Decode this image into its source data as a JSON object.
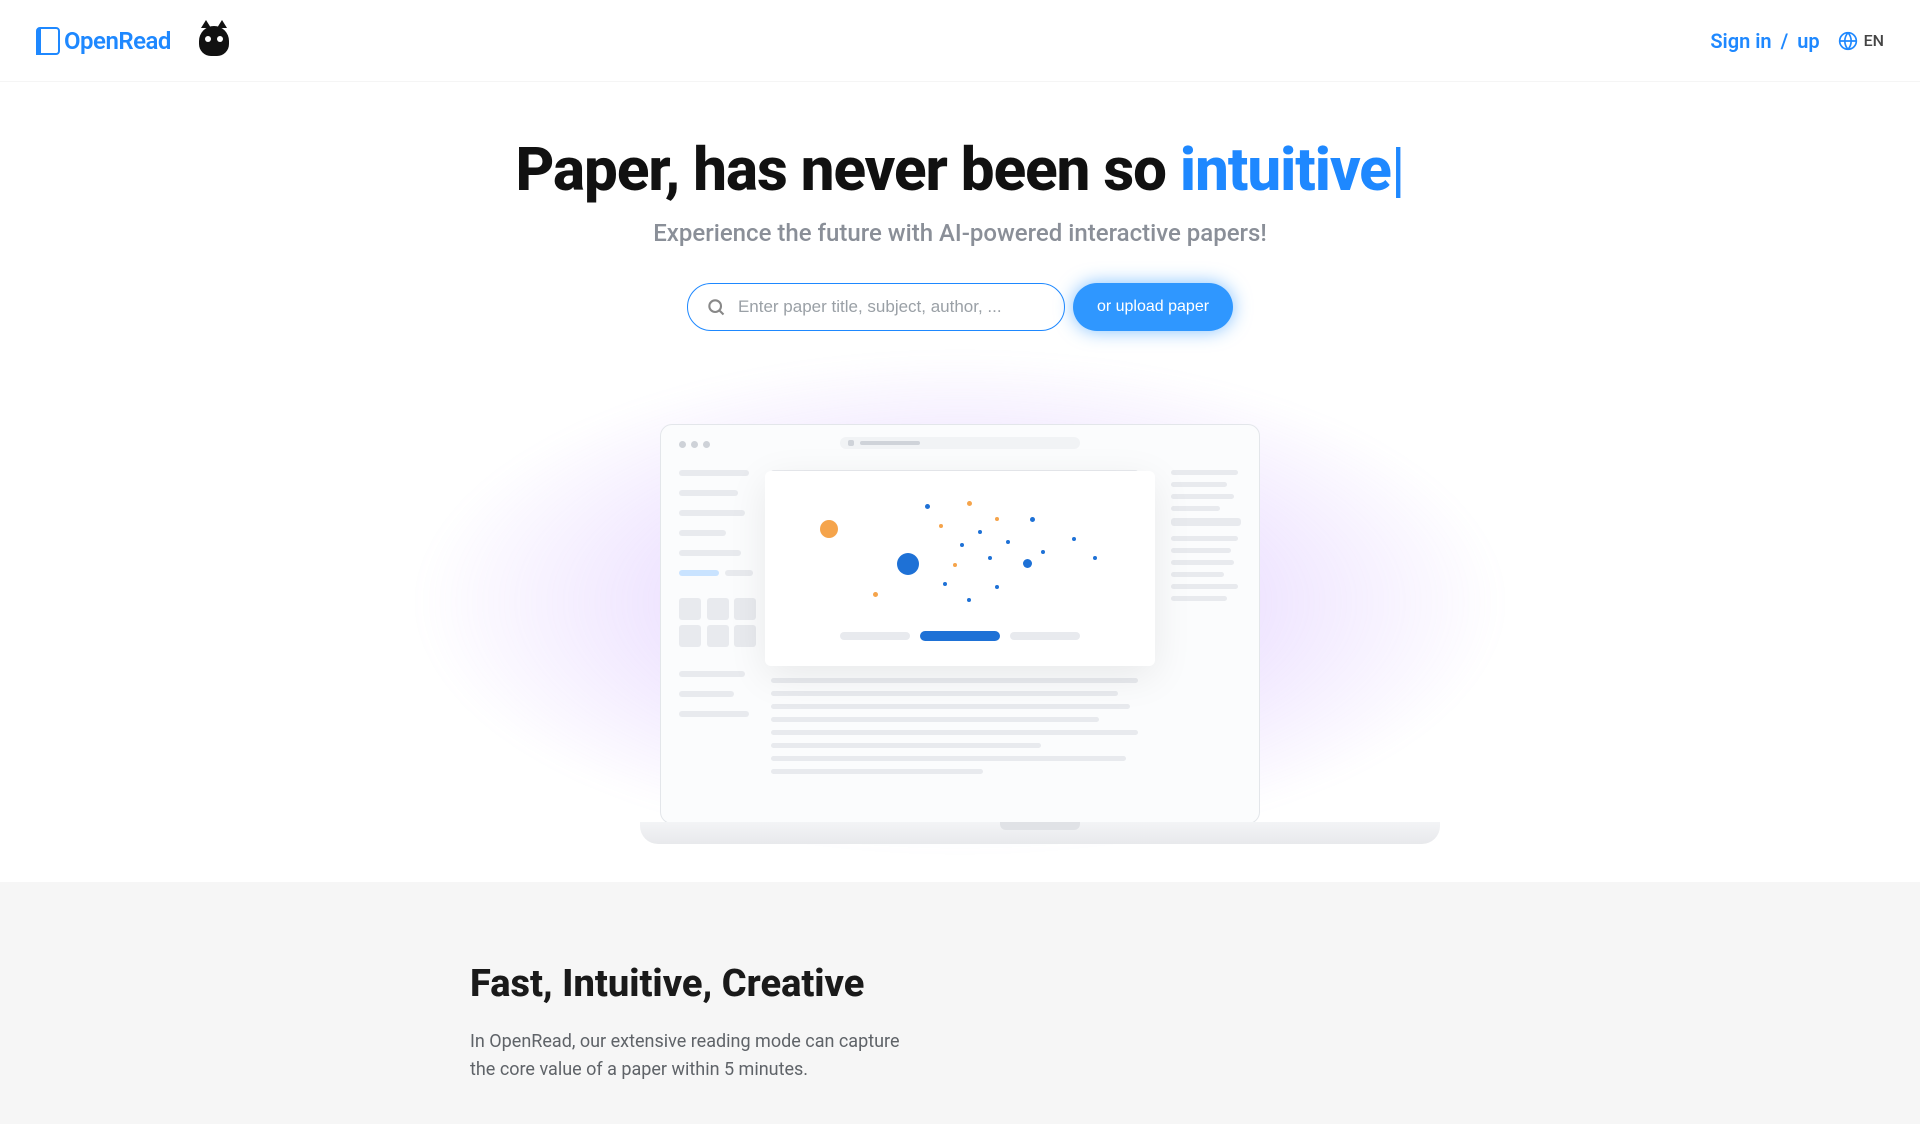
{
  "header": {
    "logo_text": "OpenRead",
    "sign_in": "Sign in",
    "auth_sep": "/",
    "sign_up": "up",
    "lang": "EN"
  },
  "hero": {
    "title_prefix": "Paper, has never been so ",
    "title_highlight": "intuitive",
    "title_cursor": "|",
    "subtitle": "Experience the future with AI-powered interactive papers!",
    "search_placeholder": "Enter paper title, subject, author, ...",
    "upload_label": "or upload paper"
  },
  "section2": {
    "heading": "Fast, Intuitive, Creative",
    "body": "In OpenRead, our extensive reading mode can capture the core value of a paper within 5 minutes."
  }
}
